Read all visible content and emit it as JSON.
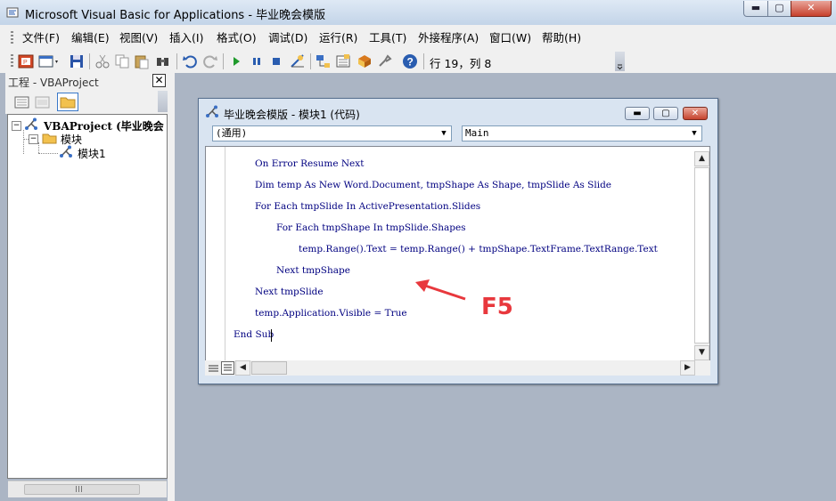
{
  "window": {
    "title": "Microsoft Visual Basic for Applications - 毕业晚会模版",
    "caption_buttons": {
      "minimize": "▬",
      "maximize": "▢",
      "close": "✕"
    }
  },
  "menu": {
    "items": [
      "文件(F)",
      "编辑(E)",
      "视图(V)",
      "插入(I)",
      "格式(O)",
      "调试(D)",
      "运行(R)",
      "工具(T)",
      "外接程序(A)",
      "窗口(W)",
      "帮助(H)"
    ]
  },
  "toolbar": {
    "cursor_position": "行 19，列 8",
    "icons": [
      "view-powerpoint-icon",
      "insert-userform-icon",
      "save-icon",
      "cut-icon",
      "copy-icon",
      "paste-icon",
      "find-icon",
      "undo-icon",
      "redo-icon",
      "run-icon",
      "break-icon",
      "reset-icon",
      "design-mode-icon",
      "project-explorer-icon",
      "properties-icon",
      "object-browser-icon",
      "toolbox-icon",
      "help-icon"
    ]
  },
  "project": {
    "title": "工程 - VBAProject",
    "close_glyph": "✕",
    "tree": {
      "root": "VBAProject (毕业晚会",
      "folder": "模块",
      "module": "模块1"
    }
  },
  "code_window": {
    "title": "毕业晚会模版 - 模块1 (代码)",
    "object_combo": "(通用)",
    "proc_combo": "Main",
    "lines": [
      {
        "indent": 1,
        "text": "On Error Resume Next"
      },
      {
        "indent": 1,
        "text": "Dim temp As New Word.Document, tmpShape As Shape, tmpSlide As Slide"
      },
      {
        "indent": 1,
        "text": "For Each tmpSlide In ActivePresentation.Slides"
      },
      {
        "indent": 2,
        "text": "For Each tmpShape In tmpSlide.Shapes"
      },
      {
        "indent": 3,
        "text": "temp.Range().Text = temp.Range() + tmpShape.TextFrame.TextRange.Text"
      },
      {
        "indent": 2,
        "text": "Next tmpShape"
      },
      {
        "indent": 1,
        "text": "Next tmpSlide"
      },
      {
        "indent": 1,
        "text": "temp.Application.Visible = True"
      },
      {
        "indent": 0,
        "text": "End Sub"
      }
    ]
  },
  "annotation": {
    "label": "F5",
    "color": "#e8383d"
  }
}
